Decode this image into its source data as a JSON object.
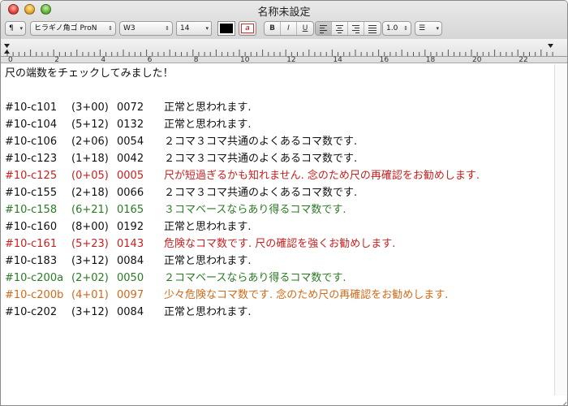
{
  "window": {
    "title": "名称未設定"
  },
  "toolbar": {
    "para_style_label": "¶",
    "font_family": "ヒラギノ角ゴ ProN",
    "font_weight": "W3",
    "font_size": "14",
    "bold_label": "B",
    "italic_label": "I",
    "underline_label": "U",
    "highlight_label": "a",
    "line_spacing": "1.0",
    "list_label": "☰"
  },
  "ruler": {
    "labels": [
      "0",
      "2",
      "4",
      "6",
      "8",
      "10",
      "12",
      "14",
      "16",
      "18",
      "20",
      "22"
    ]
  },
  "colors": {
    "black": "#111111",
    "red": "#c8201f",
    "green": "#2a7a24",
    "orange": "#d26a18"
  },
  "document": {
    "heading": "尺の端数をチェックしてみました！",
    "rows": [
      {
        "id": "#10-c101",
        "sec": "(3+00)",
        "num": "0072",
        "msg": "正常と思われます.",
        "color": "black"
      },
      {
        "id": "#10-c104",
        "sec": "(5+12)",
        "num": "0132",
        "msg": "正常と思われます.",
        "color": "black"
      },
      {
        "id": "#10-c106",
        "sec": "(2+06)",
        "num": "0054",
        "msg": "２コマ３コマ共通のよくあるコマ数です.",
        "color": "black"
      },
      {
        "id": "#10-c123",
        "sec": "(1+18)",
        "num": "0042",
        "msg": "２コマ３コマ共通のよくあるコマ数です.",
        "color": "black"
      },
      {
        "id": "#10-c125",
        "sec": "(0+05)",
        "num": "0005",
        "msg": "尺が短過ぎるかも知れません. 念のため尺の再確認をお勧めします.",
        "color": "red"
      },
      {
        "id": "#10-c155",
        "sec": "(2+18)",
        "num": "0066",
        "msg": "２コマ３コマ共通のよくあるコマ数です.",
        "color": "black"
      },
      {
        "id": "#10-c158",
        "sec": "(6+21)",
        "num": "0165",
        "msg": "３コマベースならあり得るコマ数です.",
        "color": "green"
      },
      {
        "id": "#10-c160",
        "sec": "(8+00)",
        "num": "0192",
        "msg": "正常と思われます.",
        "color": "black"
      },
      {
        "id": "#10-c161",
        "sec": "(5+23)",
        "num": "0143",
        "msg": "危険なコマ数です. 尺の確認を強くお勧めします.",
        "color": "red"
      },
      {
        "id": "#10-c183",
        "sec": "(3+12)",
        "num": "0084",
        "msg": "正常と思われます.",
        "color": "black"
      },
      {
        "id": "#10-c200a",
        "sec": "(2+02)",
        "num": "0050",
        "msg": "２コマベースならあり得るコマ数です.",
        "color": "green"
      },
      {
        "id": "#10-c200b",
        "sec": "(4+01)",
        "num": "0097",
        "msg": "少々危険なコマ数です. 念のため尺の再確認をお勧めします.",
        "color": "orange"
      },
      {
        "id": "#10-c202",
        "sec": "(3+12)",
        "num": "0084",
        "msg": "正常と思われます.",
        "color": "black"
      }
    ]
  }
}
